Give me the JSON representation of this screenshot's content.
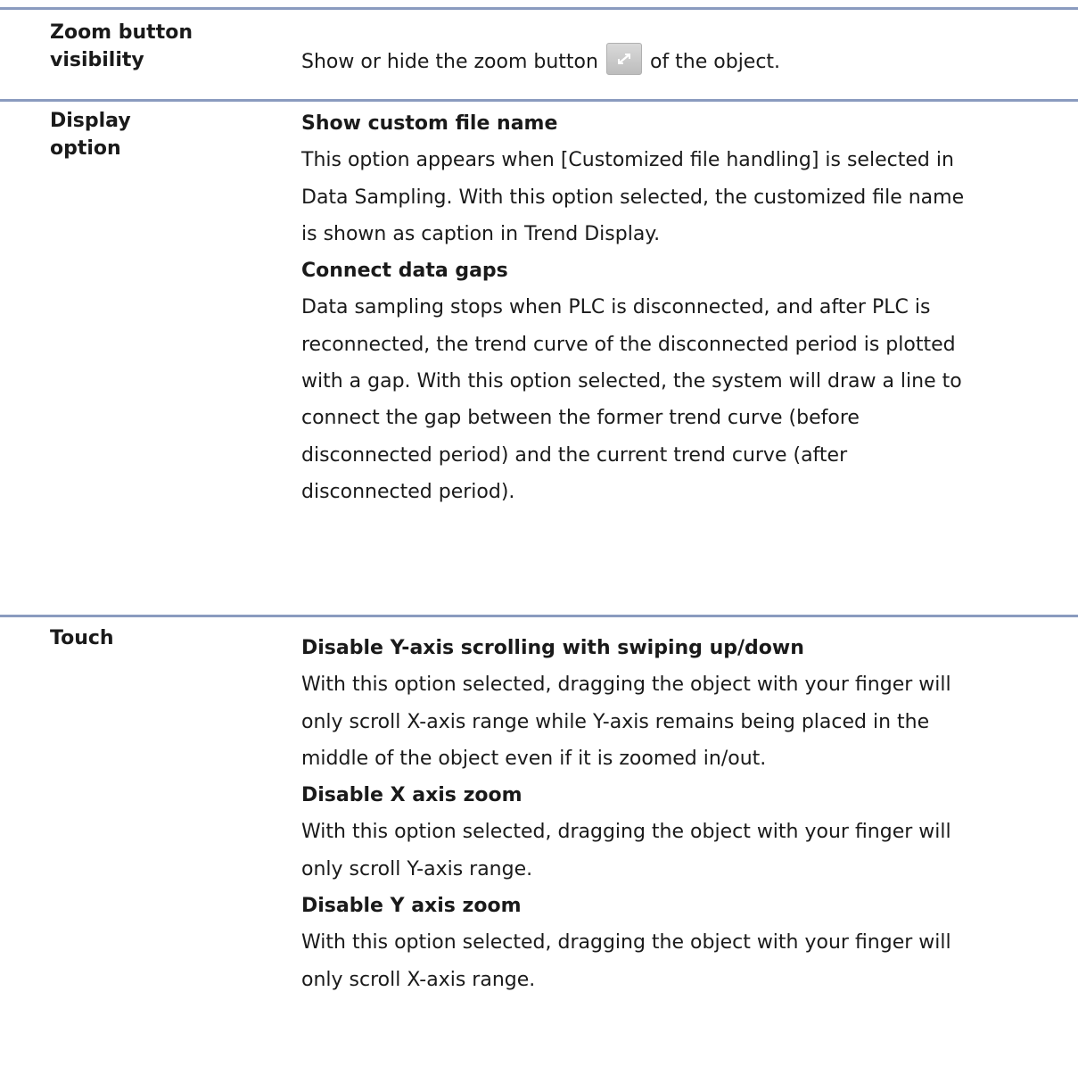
{
  "rows": [
    {
      "label_lines": [
        "Zoom button",
        "visibility"
      ],
      "text_before": "Show or hide the zoom button",
      "icon": "zoom-expand-icon",
      "text_after": "of the object."
    },
    {
      "label_lines": [
        "Display",
        "option"
      ],
      "items": [
        {
          "heading": "Show custom file name",
          "lines": [
            "This option appears when [Customized file handling] is selected in",
            "Data Sampling. With this option selected, the customized file name",
            "is shown as caption in Trend Display."
          ]
        },
        {
          "heading": "Connect data gaps",
          "lines": [
            "Data sampling stops when PLC is disconnected, and after PLC is",
            "reconnected, the trend curve of the disconnected period is plotted",
            "with a gap. With this option selected, the system will draw a line to",
            "connect the gap between the former trend curve (before",
            "disconnected period) and the current trend curve (after",
            "disconnected period)."
          ]
        }
      ]
    },
    {
      "label_lines": [
        "Touch"
      ],
      "items": [
        {
          "heading": "Disable Y-axis scrolling with swiping up/down",
          "lines": [
            "With this option selected, dragging the object with your finger will",
            "only scroll X-axis range while Y-axis remains being placed in the",
            "middle of the object even if it is zoomed in/out."
          ]
        },
        {
          "heading": "Disable X axis zoom",
          "lines": [
            "With this option selected, dragging the object with your finger will",
            "only scroll Y-axis range."
          ]
        },
        {
          "heading": "Disable Y axis zoom",
          "lines": [
            "With this option selected, dragging the object with your finger will",
            "only scroll X-axis range."
          ]
        }
      ]
    }
  ],
  "colors": {
    "separator": "#8a9bbf",
    "text": "#1a1a1a"
  }
}
